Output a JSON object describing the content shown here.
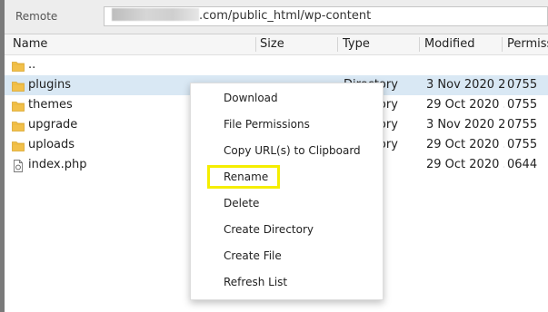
{
  "remote": {
    "label": "Remote",
    "path_suffix": ".com/public_html/wp-content"
  },
  "columns": {
    "name": "Name",
    "size": "Size",
    "type": "Type",
    "modified": "Modified",
    "permissions": "Permiss"
  },
  "files": [
    {
      "name": "..",
      "icon": "folder-icon",
      "size": "",
      "type": "",
      "modified": "",
      "permissions": "",
      "selected": false
    },
    {
      "name": "plugins",
      "icon": "folder-icon",
      "size": "",
      "type": "Directory",
      "modified": "3 Nov 2020 2...",
      "permissions": "0755",
      "selected": true
    },
    {
      "name": "themes",
      "icon": "folder-icon",
      "size": "",
      "type": "Directory",
      "modified": "29 Oct 2020 ...",
      "permissions": "0755",
      "selected": false
    },
    {
      "name": "upgrade",
      "icon": "folder-icon",
      "size": "",
      "type": "Directory",
      "modified": "3 Nov 2020 2...",
      "permissions": "0755",
      "selected": false
    },
    {
      "name": "uploads",
      "icon": "folder-icon",
      "size": "",
      "type": "Directory",
      "modified": "29 Oct 2020 ...",
      "permissions": "0755",
      "selected": false
    },
    {
      "name": "index.php",
      "icon": "php-file-icon",
      "size": "",
      "type": "",
      "modified": "29 Oct 2020 ...",
      "permissions": "0644",
      "selected": false
    }
  ],
  "context_menu": {
    "items": [
      {
        "label": "Download"
      },
      {
        "label": "File Permissions"
      },
      {
        "label": "Copy URL(s) to Clipboard"
      },
      {
        "label": "Rename",
        "highlighted": true
      },
      {
        "label": "Delete"
      },
      {
        "label": "Create Directory"
      },
      {
        "label": "Create File"
      },
      {
        "label": "Refresh List"
      }
    ]
  },
  "colors": {
    "selected_row": "#d9e8f4",
    "highlight_box": "#f5ee00",
    "folder": "#f2c04a"
  }
}
